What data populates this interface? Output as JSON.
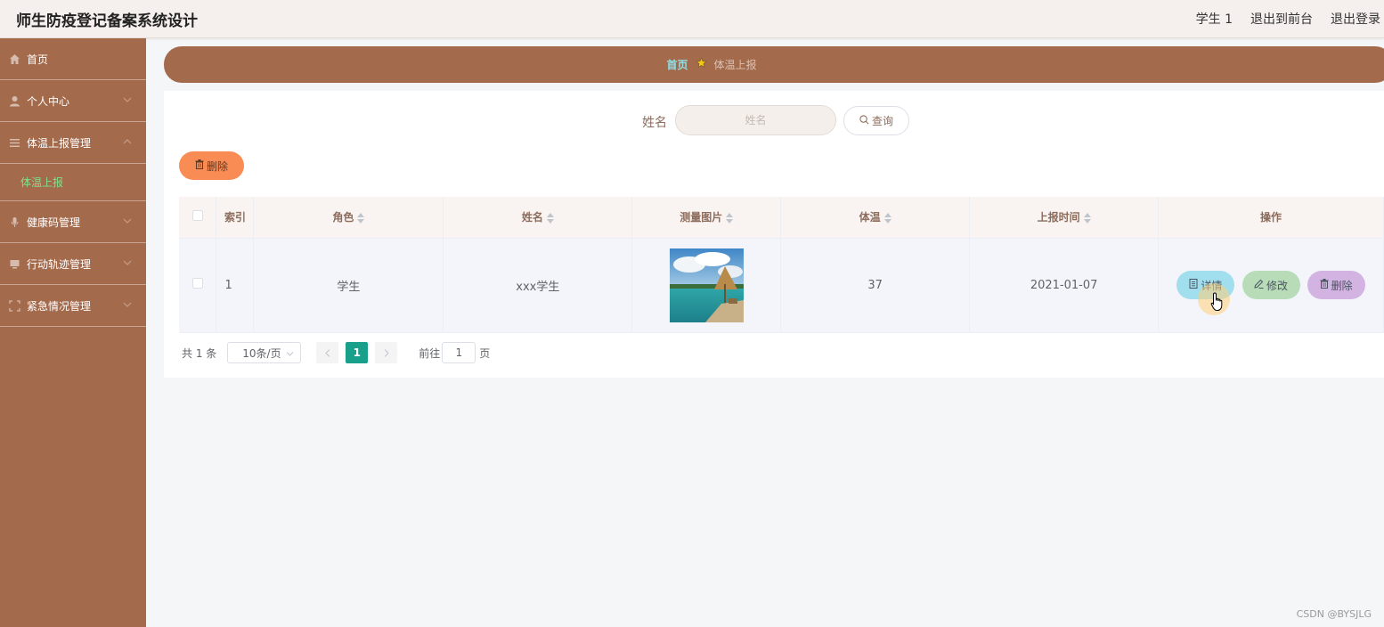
{
  "header": {
    "title": "师生防疫登记备案系统设计",
    "user": "学生 1",
    "to_front": "退出到前台",
    "logout": "退出登录"
  },
  "sidebar": {
    "items": [
      {
        "label": "首页",
        "icon": "home-icon"
      },
      {
        "label": "个人中心",
        "icon": "user-icon"
      },
      {
        "label": "体温上报管理",
        "icon": "list-icon"
      },
      {
        "label": "健康码管理",
        "icon": "mic-icon"
      },
      {
        "label": "行动轨迹管理",
        "icon": "monitor-icon"
      },
      {
        "label": "紧急情况管理",
        "icon": "frame-icon"
      }
    ],
    "active_sub": "体温上报"
  },
  "breadcrumb": {
    "home": "首页",
    "current": "体温上报"
  },
  "search": {
    "label": "姓名",
    "placeholder": "姓名",
    "button": "查询"
  },
  "bulk_delete": "删除",
  "table": {
    "columns": [
      "索引",
      "角色",
      "姓名",
      "测量图片",
      "体温",
      "上报时间",
      "操作"
    ],
    "rows": [
      {
        "index": "1",
        "role": "学生",
        "name": "xxx学生",
        "temperature": "37",
        "time": "2021-01-07"
      }
    ],
    "actions": {
      "detail": "详情",
      "edit": "修改",
      "delete": "删除"
    }
  },
  "pagination": {
    "total": "共 1 条",
    "page_size": "10条/页",
    "current": "1",
    "goto_label": "前往",
    "goto_value": "1",
    "goto_suffix": "页"
  },
  "watermark": "CSDN @BYSJLG",
  "colors": {
    "sidebar": "#a46a4c",
    "header": "#f5efed",
    "accent_green": "#19a08b",
    "delete_orange": "#f98b54"
  }
}
